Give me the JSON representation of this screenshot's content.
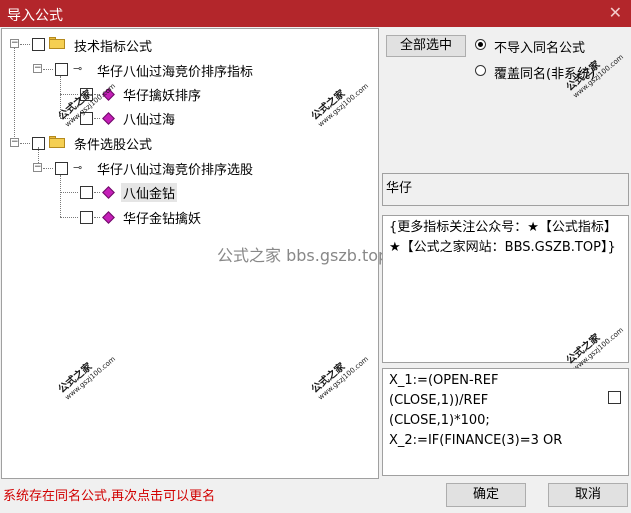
{
  "window": {
    "title": "导入公式",
    "close_glyph": "✕"
  },
  "tree": {
    "groups": [
      {
        "label": "技术指标公式",
        "child_label": "华仔八仙过海竞价排序指标",
        "leaves": [
          "华仔擒妖排序",
          "八仙过海"
        ]
      },
      {
        "label": "条件选股公式",
        "child_label": "华仔八仙过海竞价排序选股",
        "leaves": [
          "八仙金钻",
          "华仔金钻擒妖"
        ]
      }
    ],
    "selected_leaf": "八仙金钻"
  },
  "watermark": {
    "main": "公式之家",
    "url": "www.gszj100.com",
    "center_text": "公式之家 bbs.gszb.top"
  },
  "right": {
    "select_all": "全部选中",
    "options": [
      {
        "label": "不导入同名公式",
        "selected": true
      },
      {
        "label": "覆盖同名(非系统)",
        "selected": false
      }
    ],
    "name_value": "华仔",
    "description": "{更多指标关注公众号：★【公式指标】★【公式之家网站：BBS.GSZB.TOP】}",
    "code_lines": [
      "X_1:=(OPEN-REF",
      "(CLOSE,1))/REF",
      "(CLOSE,1)*100;",
      "X_2:=IF(FINANCE(3)=3 OR"
    ]
  },
  "footer": {
    "status": "系统存在同名公式,再次点击可以更名",
    "ok": "确定",
    "cancel": "取消"
  },
  "colors": {
    "titlebar": "#b3262b",
    "status": "#d10000",
    "gem": "#c51fb8",
    "folder": "#f5cf52"
  }
}
